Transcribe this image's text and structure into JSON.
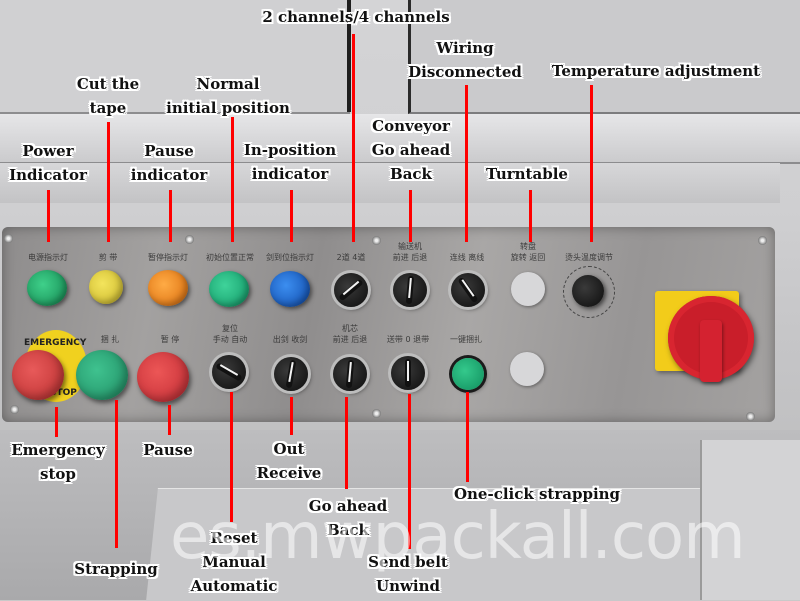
{
  "scene": "Control panel of an automatic strapping machine with annotated English callouts",
  "colors": {
    "leader_line": "#ff0000",
    "panel_steel": "#9c9a99",
    "green_lamp": "#1fa865",
    "yellow_button": "#e6d23a",
    "orange_lamp": "#f0861a",
    "blue_lamp": "#1660c8",
    "red_button": "#d8363c",
    "emergency_ring": "#f0d11f",
    "main_switch_red": "#c91e2a",
    "main_switch_yellow": "#f2cc1a"
  },
  "callouts": {
    "power_indicator": [
      "Power",
      "Indicator"
    ],
    "cut_the_tape": [
      "Cut the",
      "tape"
    ],
    "pause_indicator": [
      "Pause",
      "indicator"
    ],
    "normal_initial_position": [
      "Normal",
      "initial position"
    ],
    "in_position_indicator": [
      "In-position",
      "indicator"
    ],
    "channels": [
      "2 channels/4 channels"
    ],
    "conveyor": [
      "Conveyor",
      "Go ahead",
      "Back"
    ],
    "wiring": [
      "Wiring",
      "Disconnected"
    ],
    "turntable": [
      "Turntable"
    ],
    "temperature": [
      "Temperature adjustment"
    ],
    "emergency_stop": [
      "Emergency",
      "stop"
    ],
    "strapping": [
      "Strapping"
    ],
    "pause": [
      "Pause"
    ],
    "reset": [
      "Reset",
      "Manual",
      "Automatic"
    ],
    "out_receive": [
      "Out",
      "Receive"
    ],
    "go_ahead_back": [
      "Go ahead",
      "Back"
    ],
    "send_belt": [
      "Send belt",
      "Unwind"
    ],
    "one_click": [
      "One-click strapping"
    ]
  },
  "panel_labels_cn": {
    "power": "电源指示灯",
    "cut": "剪 带",
    "pause_ind": "暂停指示灯",
    "init_pos": "初始位置正常",
    "in_pos": "剑到位指示灯",
    "channels": "2道  4道",
    "conveyor_title": "输送机",
    "conveyor": "前进  后退",
    "wiring": "连线  离线",
    "turntable_title": "转盘",
    "turntable": "旋转  返回",
    "temperature": "烫头温度调节",
    "strap": "捆 扎",
    "pause": "暂 停",
    "reset_title": "复位",
    "reset": "手动  自动",
    "out_receive": "出剑  收剑",
    "core_title": "机芯",
    "core": "前进  后退",
    "send_belt": "送带 0 退带",
    "one_click": "一键捆扎"
  },
  "emergency_text": {
    "top": "EMERGENCY",
    "bottom": "STOP"
  },
  "dial": {
    "scale_min": 0,
    "scale_max": 10,
    "ticks": [
      "0",
      "1",
      "2",
      "3",
      "4",
      "5",
      "6",
      "7",
      "8",
      "9",
      "10"
    ]
  },
  "watermark": "es.mwpackall.com"
}
